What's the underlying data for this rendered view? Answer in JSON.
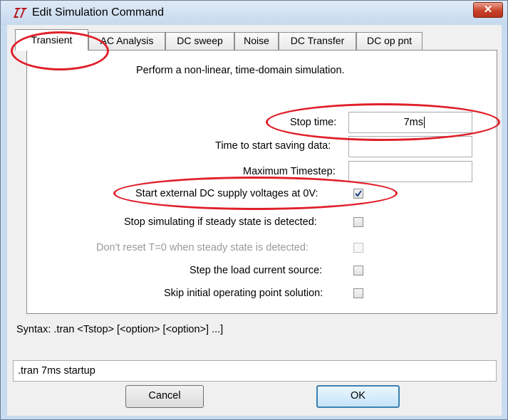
{
  "window": {
    "title": "Edit Simulation Command",
    "close_label": "✕"
  },
  "tabs": [
    {
      "label": "Transient",
      "active": true
    },
    {
      "label": "AC Analysis",
      "active": false
    },
    {
      "label": "DC sweep",
      "active": false
    },
    {
      "label": "Noise",
      "active": false
    },
    {
      "label": "DC Transfer",
      "active": false
    },
    {
      "label": "DC op pnt",
      "active": false
    }
  ],
  "transient": {
    "description": "Perform a non-linear, time-domain simulation.",
    "stop_time_label": "Stop time:",
    "stop_time_value": "7ms",
    "start_saving_label": "Time to start saving data:",
    "start_saving_value": "",
    "max_timestep_label": "Maximum Timestep:",
    "max_timestep_value": "",
    "options": [
      {
        "label": "Start external DC supply voltages at 0V:",
        "checked": true,
        "enabled": true
      },
      {
        "label": "Stop simulating if steady state is detected:",
        "checked": false,
        "enabled": true
      },
      {
        "label": "Don't reset T=0 when steady state is detected:",
        "checked": false,
        "enabled": false
      },
      {
        "label": "Step the load current source:",
        "checked": false,
        "enabled": true
      },
      {
        "label": "Skip initial operating point solution:",
        "checked": false,
        "enabled": true
      }
    ]
  },
  "syntax": "Syntax:  .tran <Tstop> [<option> [<option>] ...]",
  "command_line": ".tran 7ms startup",
  "buttons": {
    "cancel": "Cancel",
    "ok": "OK"
  },
  "colors": {
    "annotation": "#e0202b",
    "checkmark": "#1e3f8a"
  }
}
